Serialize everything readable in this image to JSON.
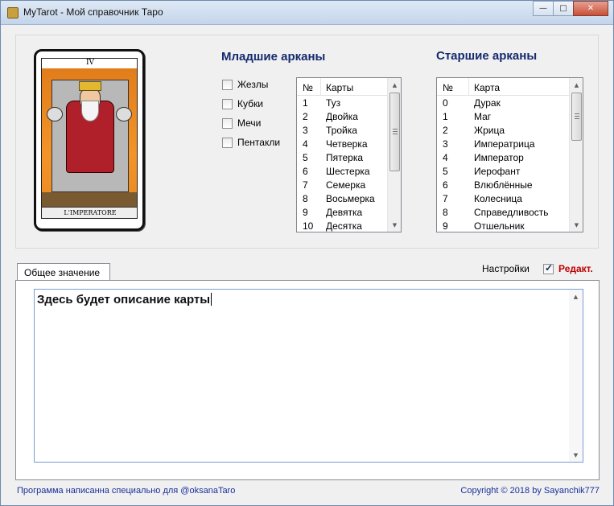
{
  "window": {
    "title": "MyTarot - Мой справочник Таро",
    "buttons": {
      "minimize": "—",
      "maximize": "□",
      "close": "✕"
    }
  },
  "card": {
    "number": "IV",
    "name": "L'IMPERATORE",
    "icon": "emperor-card-image"
  },
  "minor": {
    "title": "Младшие арканы",
    "suits": [
      {
        "label": "Жезлы",
        "checked": false
      },
      {
        "label": "Кубки",
        "checked": false
      },
      {
        "label": "Мечи",
        "checked": false
      },
      {
        "label": "Пентакли",
        "checked": false
      }
    ],
    "list": {
      "col_num": "№",
      "col_name": "Карты",
      "rows": [
        {
          "num": "1",
          "name": "Туз"
        },
        {
          "num": "2",
          "name": "Двойка"
        },
        {
          "num": "3",
          "name": "Тройка"
        },
        {
          "num": "4",
          "name": "Четверка"
        },
        {
          "num": "5",
          "name": "Пятерка"
        },
        {
          "num": "6",
          "name": "Шестерка"
        },
        {
          "num": "7",
          "name": "Семерка"
        },
        {
          "num": "8",
          "name": "Восьмерка"
        },
        {
          "num": "9",
          "name": "Девятка"
        },
        {
          "num": "10",
          "name": "Десятка"
        }
      ]
    }
  },
  "major": {
    "title": "Старшие арканы",
    "list": {
      "col_num": "№",
      "col_name": "Карта",
      "rows": [
        {
          "num": "0",
          "name": "Дурак"
        },
        {
          "num": "1",
          "name": "Маг"
        },
        {
          "num": "2",
          "name": "Жрица"
        },
        {
          "num": "3",
          "name": "Императрица"
        },
        {
          "num": "4",
          "name": "Император"
        },
        {
          "num": "5",
          "name": "Иерофант"
        },
        {
          "num": "6",
          "name": "Влюблённые"
        },
        {
          "num": "7",
          "name": "Колесница"
        },
        {
          "num": "8",
          "name": "Справедливость"
        },
        {
          "num": "9",
          "name": "Отшельник"
        }
      ]
    }
  },
  "tabs": [
    {
      "label": "Общее значение",
      "active": true
    }
  ],
  "settings": {
    "label": "Настройки"
  },
  "edit": {
    "label": "Редакт.",
    "checked": true
  },
  "description": {
    "text": "Здесь будет описание карты"
  },
  "footer": {
    "left": "Программа написанна специально для @oksanaTaro",
    "right": "Copyright © 2018 by Sayanchik777"
  },
  "colors": {
    "heading": "#152a6e",
    "edit_label": "#c00000",
    "footer": "#1a2f9a"
  }
}
